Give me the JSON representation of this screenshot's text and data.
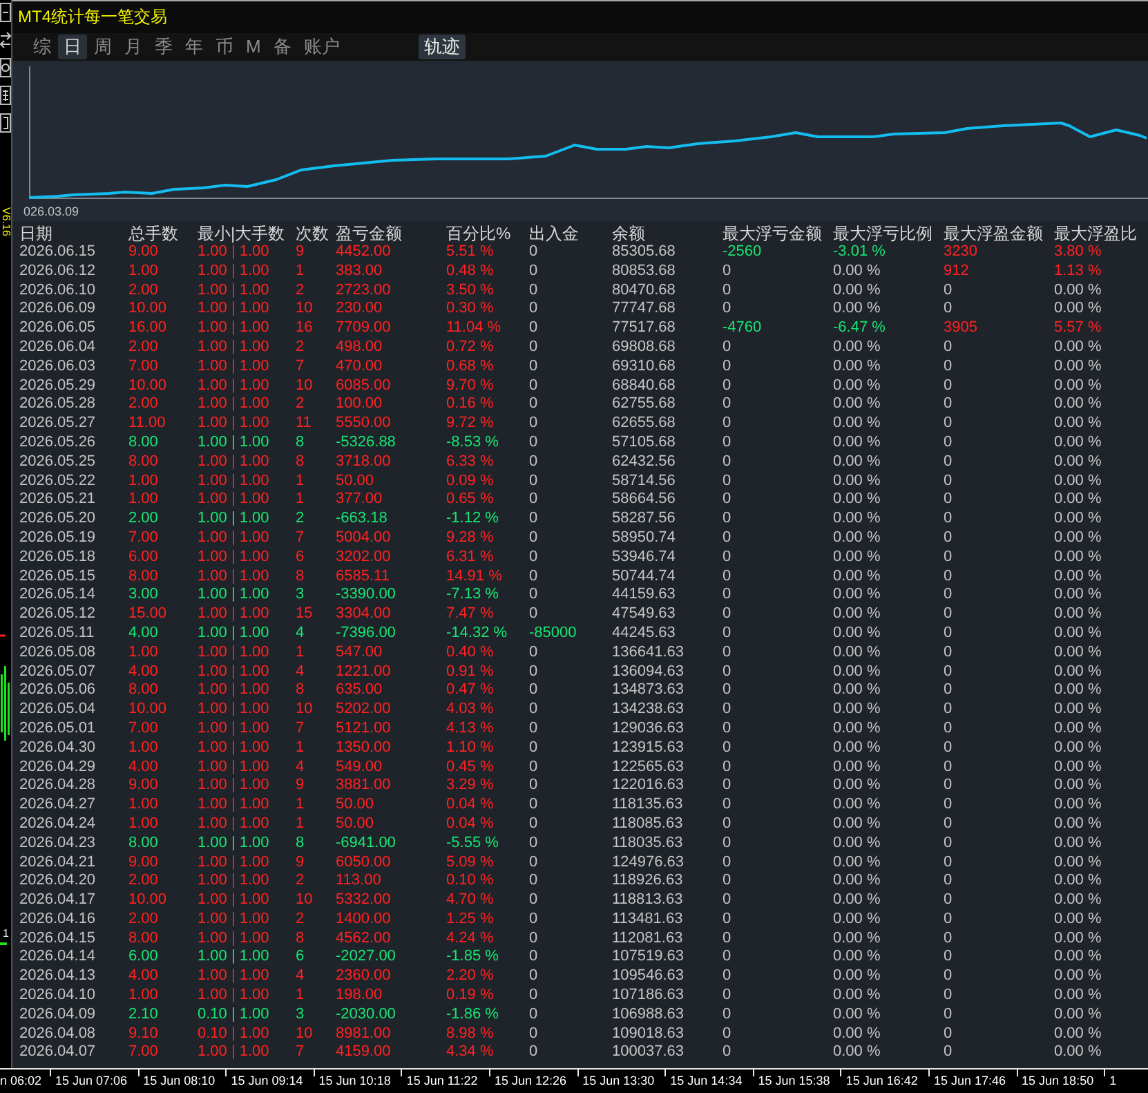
{
  "window": {
    "title": "MT4统计每一笔交易"
  },
  "side_label": "V6.16",
  "price_label": "1",
  "tabs": [
    {
      "label": "综",
      "selected": false
    },
    {
      "label": "日",
      "selected": true
    },
    {
      "label": "周",
      "selected": false
    },
    {
      "label": "月",
      "selected": false
    },
    {
      "label": "季",
      "selected": false
    },
    {
      "label": "年",
      "selected": false
    },
    {
      "label": "币",
      "selected": false
    },
    {
      "label": "M",
      "selected": false
    },
    {
      "label": "备",
      "selected": false
    },
    {
      "label": "账户",
      "selected": false
    }
  ],
  "trajectory_button": {
    "label": "轨迹",
    "on": true
  },
  "chart": {
    "start_label": "026.03.09"
  },
  "table": {
    "columns": [
      {
        "label": "日期",
        "kind": "plain"
      },
      {
        "label": "总手数",
        "kind": "result"
      },
      {
        "label": "最小|大手数",
        "kind": "result"
      },
      {
        "label": "次数",
        "kind": "result"
      },
      {
        "label": "盈亏金额",
        "kind": "result"
      },
      {
        "label": "百分比%",
        "kind": "result"
      },
      {
        "label": "出入金",
        "kind": "withdrawal"
      },
      {
        "label": "余额",
        "kind": "plain"
      },
      {
        "label": "最大浮亏金额",
        "kind": "floating_loss"
      },
      {
        "label": "最大浮亏比例",
        "kind": "floating_loss"
      },
      {
        "label": "最大浮盈金额",
        "kind": "floating_gain"
      },
      {
        "label": "最大浮盈比",
        "kind": "floating_gain"
      }
    ],
    "rows": [
      {
        "kind": "gain",
        "withdrawal": false,
        "floating_loss": true,
        "floating_gain": true,
        "cells": [
          "2026.06.15",
          "9.00",
          "1.00 | 1.00",
          "9",
          "4452.00",
          "5.51 %",
          "0",
          "85305.68",
          "-2560",
          "-3.01 %",
          "3230",
          "3.80 %"
        ]
      },
      {
        "kind": "gain",
        "withdrawal": false,
        "floating_loss": false,
        "floating_gain": true,
        "cells": [
          "2026.06.12",
          "1.00",
          "1.00 | 1.00",
          "1",
          "383.00",
          "0.48 %",
          "0",
          "80853.68",
          "0",
          "0.00 %",
          "912",
          "1.13 %"
        ]
      },
      {
        "kind": "gain",
        "withdrawal": false,
        "floating_loss": false,
        "floating_gain": false,
        "cells": [
          "2026.06.10",
          "2.00",
          "1.00 | 1.00",
          "2",
          "2723.00",
          "3.50 %",
          "0",
          "80470.68",
          "0",
          "0.00 %",
          "0",
          "0.00 %"
        ]
      },
      {
        "kind": "gain",
        "withdrawal": false,
        "floating_loss": false,
        "floating_gain": false,
        "cells": [
          "2026.06.09",
          "10.00",
          "1.00 | 1.00",
          "10",
          "230.00",
          "0.30 %",
          "0",
          "77747.68",
          "0",
          "0.00 %",
          "0",
          "0.00 %"
        ]
      },
      {
        "kind": "gain",
        "withdrawal": false,
        "floating_loss": true,
        "floating_gain": true,
        "cells": [
          "2026.06.05",
          "16.00",
          "1.00 | 1.00",
          "16",
          "7709.00",
          "11.04 %",
          "0",
          "77517.68",
          "-4760",
          "-6.47 %",
          "3905",
          "5.57 %"
        ]
      },
      {
        "kind": "gain",
        "withdrawal": false,
        "floating_loss": false,
        "floating_gain": false,
        "cells": [
          "2026.06.04",
          "2.00",
          "1.00 | 1.00",
          "2",
          "498.00",
          "0.72 %",
          "0",
          "69808.68",
          "0",
          "0.00 %",
          "0",
          "0.00 %"
        ]
      },
      {
        "kind": "gain",
        "withdrawal": false,
        "floating_loss": false,
        "floating_gain": false,
        "cells": [
          "2026.06.03",
          "7.00",
          "1.00 | 1.00",
          "7",
          "470.00",
          "0.68 %",
          "0",
          "69310.68",
          "0",
          "0.00 %",
          "0",
          "0.00 %"
        ]
      },
      {
        "kind": "gain",
        "withdrawal": false,
        "floating_loss": false,
        "floating_gain": false,
        "cells": [
          "2026.05.29",
          "10.00",
          "1.00 | 1.00",
          "10",
          "6085.00",
          "9.70 %",
          "0",
          "68840.68",
          "0",
          "0.00 %",
          "0",
          "0.00 %"
        ]
      },
      {
        "kind": "gain",
        "withdrawal": false,
        "floating_loss": false,
        "floating_gain": false,
        "cells": [
          "2026.05.28",
          "2.00",
          "1.00 | 1.00",
          "2",
          "100.00",
          "0.16 %",
          "0",
          "62755.68",
          "0",
          "0.00 %",
          "0",
          "0.00 %"
        ]
      },
      {
        "kind": "gain",
        "withdrawal": false,
        "floating_loss": false,
        "floating_gain": false,
        "cells": [
          "2026.05.27",
          "11.00",
          "1.00 | 1.00",
          "11",
          "5550.00",
          "9.72 %",
          "0",
          "62655.68",
          "0",
          "0.00 %",
          "0",
          "0.00 %"
        ]
      },
      {
        "kind": "loss",
        "withdrawal": false,
        "floating_loss": false,
        "floating_gain": false,
        "cells": [
          "2026.05.26",
          "8.00",
          "1.00 | 1.00",
          "8",
          "-5326.88",
          "-8.53 %",
          "0",
          "57105.68",
          "0",
          "0.00 %",
          "0",
          "0.00 %"
        ]
      },
      {
        "kind": "gain",
        "withdrawal": false,
        "floating_loss": false,
        "floating_gain": false,
        "cells": [
          "2026.05.25",
          "8.00",
          "1.00 | 1.00",
          "8",
          "3718.00",
          "6.33 %",
          "0",
          "62432.56",
          "0",
          "0.00 %",
          "0",
          "0.00 %"
        ]
      },
      {
        "kind": "gain",
        "withdrawal": false,
        "floating_loss": false,
        "floating_gain": false,
        "cells": [
          "2026.05.22",
          "1.00",
          "1.00 | 1.00",
          "1",
          "50.00",
          "0.09 %",
          "0",
          "58714.56",
          "0",
          "0.00 %",
          "0",
          "0.00 %"
        ]
      },
      {
        "kind": "gain",
        "withdrawal": false,
        "floating_loss": false,
        "floating_gain": false,
        "cells": [
          "2026.05.21",
          "1.00",
          "1.00 | 1.00",
          "1",
          "377.00",
          "0.65 %",
          "0",
          "58664.56",
          "0",
          "0.00 %",
          "0",
          "0.00 %"
        ]
      },
      {
        "kind": "loss",
        "withdrawal": false,
        "floating_loss": false,
        "floating_gain": false,
        "cells": [
          "2026.05.20",
          "2.00",
          "1.00 | 1.00",
          "2",
          "-663.18",
          "-1.12 %",
          "0",
          "58287.56",
          "0",
          "0.00 %",
          "0",
          "0.00 %"
        ]
      },
      {
        "kind": "gain",
        "withdrawal": false,
        "floating_loss": false,
        "floating_gain": false,
        "cells": [
          "2026.05.19",
          "7.00",
          "1.00 | 1.00",
          "7",
          "5004.00",
          "9.28 %",
          "0",
          "58950.74",
          "0",
          "0.00 %",
          "0",
          "0.00 %"
        ]
      },
      {
        "kind": "gain",
        "withdrawal": false,
        "floating_loss": false,
        "floating_gain": false,
        "cells": [
          "2026.05.18",
          "6.00",
          "1.00 | 1.00",
          "6",
          "3202.00",
          "6.31 %",
          "0",
          "53946.74",
          "0",
          "0.00 %",
          "0",
          "0.00 %"
        ]
      },
      {
        "kind": "gain",
        "withdrawal": false,
        "floating_loss": false,
        "floating_gain": false,
        "cells": [
          "2026.05.15",
          "8.00",
          "1.00 | 1.00",
          "8",
          "6585.11",
          "14.91 %",
          "0",
          "50744.74",
          "0",
          "0.00 %",
          "0",
          "0.00 %"
        ]
      },
      {
        "kind": "loss",
        "withdrawal": false,
        "floating_loss": false,
        "floating_gain": false,
        "cells": [
          "2026.05.14",
          "3.00",
          "1.00 | 1.00",
          "3",
          "-3390.00",
          "-7.13 %",
          "0",
          "44159.63",
          "0",
          "0.00 %",
          "0",
          "0.00 %"
        ]
      },
      {
        "kind": "gain",
        "withdrawal": false,
        "floating_loss": false,
        "floating_gain": false,
        "cells": [
          "2026.05.12",
          "15.00",
          "1.00 | 1.00",
          "15",
          "3304.00",
          "7.47 %",
          "0",
          "47549.63",
          "0",
          "0.00 %",
          "0",
          "0.00 %"
        ]
      },
      {
        "kind": "loss",
        "withdrawal": true,
        "floating_loss": false,
        "floating_gain": false,
        "cells": [
          "2026.05.11",
          "4.00",
          "1.00 | 1.00",
          "4",
          "-7396.00",
          "-14.32 %",
          "-85000",
          "44245.63",
          "0",
          "0.00 %",
          "0",
          "0.00 %"
        ]
      },
      {
        "kind": "gain",
        "withdrawal": false,
        "floating_loss": false,
        "floating_gain": false,
        "cells": [
          "2026.05.08",
          "1.00",
          "1.00 | 1.00",
          "1",
          "547.00",
          "0.40 %",
          "0",
          "136641.63",
          "0",
          "0.00 %",
          "0",
          "0.00 %"
        ]
      },
      {
        "kind": "gain",
        "withdrawal": false,
        "floating_loss": false,
        "floating_gain": false,
        "cells": [
          "2026.05.07",
          "4.00",
          "1.00 | 1.00",
          "4",
          "1221.00",
          "0.91 %",
          "0",
          "136094.63",
          "0",
          "0.00 %",
          "0",
          "0.00 %"
        ]
      },
      {
        "kind": "gain",
        "withdrawal": false,
        "floating_loss": false,
        "floating_gain": false,
        "cells": [
          "2026.05.06",
          "8.00",
          "1.00 | 1.00",
          "8",
          "635.00",
          "0.47 %",
          "0",
          "134873.63",
          "0",
          "0.00 %",
          "0",
          "0.00 %"
        ]
      },
      {
        "kind": "gain",
        "withdrawal": false,
        "floating_loss": false,
        "floating_gain": false,
        "cells": [
          "2026.05.04",
          "10.00",
          "1.00 | 1.00",
          "10",
          "5202.00",
          "4.03 %",
          "0",
          "134238.63",
          "0",
          "0.00 %",
          "0",
          "0.00 %"
        ]
      },
      {
        "kind": "gain",
        "withdrawal": false,
        "floating_loss": false,
        "floating_gain": false,
        "cells": [
          "2026.05.01",
          "7.00",
          "1.00 | 1.00",
          "7",
          "5121.00",
          "4.13 %",
          "0",
          "129036.63",
          "0",
          "0.00 %",
          "0",
          "0.00 %"
        ]
      },
      {
        "kind": "gain",
        "withdrawal": false,
        "floating_loss": false,
        "floating_gain": false,
        "cells": [
          "2026.04.30",
          "1.00",
          "1.00 | 1.00",
          "1",
          "1350.00",
          "1.10 %",
          "0",
          "123915.63",
          "0",
          "0.00 %",
          "0",
          "0.00 %"
        ]
      },
      {
        "kind": "gain",
        "withdrawal": false,
        "floating_loss": false,
        "floating_gain": false,
        "cells": [
          "2026.04.29",
          "4.00",
          "1.00 | 1.00",
          "4",
          "549.00",
          "0.45 %",
          "0",
          "122565.63",
          "0",
          "0.00 %",
          "0",
          "0.00 %"
        ]
      },
      {
        "kind": "gain",
        "withdrawal": false,
        "floating_loss": false,
        "floating_gain": false,
        "cells": [
          "2026.04.28",
          "9.00",
          "1.00 | 1.00",
          "9",
          "3881.00",
          "3.29 %",
          "0",
          "122016.63",
          "0",
          "0.00 %",
          "0",
          "0.00 %"
        ]
      },
      {
        "kind": "gain",
        "withdrawal": false,
        "floating_loss": false,
        "floating_gain": false,
        "cells": [
          "2026.04.27",
          "1.00",
          "1.00 | 1.00",
          "1",
          "50.00",
          "0.04 %",
          "0",
          "118135.63",
          "0",
          "0.00 %",
          "0",
          "0.00 %"
        ]
      },
      {
        "kind": "gain",
        "withdrawal": false,
        "floating_loss": false,
        "floating_gain": false,
        "cells": [
          "2026.04.24",
          "1.00",
          "1.00 | 1.00",
          "1",
          "50.00",
          "0.04 %",
          "0",
          "118085.63",
          "0",
          "0.00 %",
          "0",
          "0.00 %"
        ]
      },
      {
        "kind": "loss",
        "withdrawal": false,
        "floating_loss": false,
        "floating_gain": false,
        "cells": [
          "2026.04.23",
          "8.00",
          "1.00 | 1.00",
          "8",
          "-6941.00",
          "-5.55 %",
          "0",
          "118035.63",
          "0",
          "0.00 %",
          "0",
          "0.00 %"
        ]
      },
      {
        "kind": "gain",
        "withdrawal": false,
        "floating_loss": false,
        "floating_gain": false,
        "cells": [
          "2026.04.21",
          "9.00",
          "1.00 | 1.00",
          "9",
          "6050.00",
          "5.09 %",
          "0",
          "124976.63",
          "0",
          "0.00 %",
          "0",
          "0.00 %"
        ]
      },
      {
        "kind": "gain",
        "withdrawal": false,
        "floating_loss": false,
        "floating_gain": false,
        "cells": [
          "2026.04.20",
          "2.00",
          "1.00 | 1.00",
          "2",
          "113.00",
          "0.10 %",
          "0",
          "118926.63",
          "0",
          "0.00 %",
          "0",
          "0.00 %"
        ]
      },
      {
        "kind": "gain",
        "withdrawal": false,
        "floating_loss": false,
        "floating_gain": false,
        "cells": [
          "2026.04.17",
          "10.00",
          "1.00 | 1.00",
          "10",
          "5332.00",
          "4.70 %",
          "0",
          "118813.63",
          "0",
          "0.00 %",
          "0",
          "0.00 %"
        ]
      },
      {
        "kind": "gain",
        "withdrawal": false,
        "floating_loss": false,
        "floating_gain": false,
        "cells": [
          "2026.04.16",
          "2.00",
          "1.00 | 1.00",
          "2",
          "1400.00",
          "1.25 %",
          "0",
          "113481.63",
          "0",
          "0.00 %",
          "0",
          "0.00 %"
        ]
      },
      {
        "kind": "gain",
        "withdrawal": false,
        "floating_loss": false,
        "floating_gain": false,
        "cells": [
          "2026.04.15",
          "8.00",
          "1.00 | 1.00",
          "8",
          "4562.00",
          "4.24 %",
          "0",
          "112081.63",
          "0",
          "0.00 %",
          "0",
          "0.00 %"
        ]
      },
      {
        "kind": "loss",
        "withdrawal": false,
        "floating_loss": false,
        "floating_gain": false,
        "cells": [
          "2026.04.14",
          "6.00",
          "1.00 | 1.00",
          "6",
          "-2027.00",
          "-1.85 %",
          "0",
          "107519.63",
          "0",
          "0.00 %",
          "0",
          "0.00 %"
        ]
      },
      {
        "kind": "gain",
        "withdrawal": false,
        "floating_loss": false,
        "floating_gain": false,
        "cells": [
          "2026.04.13",
          "4.00",
          "1.00 | 1.00",
          "4",
          "2360.00",
          "2.20 %",
          "0",
          "109546.63",
          "0",
          "0.00 %",
          "0",
          "0.00 %"
        ]
      },
      {
        "kind": "gain",
        "withdrawal": false,
        "floating_loss": false,
        "floating_gain": false,
        "cells": [
          "2026.04.10",
          "1.00",
          "1.00 | 1.00",
          "1",
          "198.00",
          "0.19 %",
          "0",
          "107186.63",
          "0",
          "0.00 %",
          "0",
          "0.00 %"
        ]
      },
      {
        "kind": "loss",
        "withdrawal": false,
        "floating_loss": false,
        "floating_gain": false,
        "cells": [
          "2026.04.09",
          "2.10",
          "0.10 | 1.00",
          "3",
          "-2030.00",
          "-1.86 %",
          "0",
          "106988.63",
          "0",
          "0.00 %",
          "0",
          "0.00 %"
        ]
      },
      {
        "kind": "gain",
        "withdrawal": false,
        "floating_loss": false,
        "floating_gain": false,
        "cells": [
          "2026.04.08",
          "9.10",
          "0.10 | 1.00",
          "10",
          "8981.00",
          "8.98 %",
          "0",
          "109018.63",
          "0",
          "0.00 %",
          "0",
          "0.00 %"
        ]
      },
      {
        "kind": "gain",
        "withdrawal": false,
        "floating_loss": false,
        "floating_gain": false,
        "cells": [
          "2026.04.07",
          "7.00",
          "1.00 | 1.00",
          "7",
          "4159.00",
          "4.34 %",
          "0",
          "100037.63",
          "0",
          "0.00 %",
          "0",
          "0.00 %"
        ]
      }
    ]
  },
  "time_axis": {
    "labels": [
      "n 06:02",
      "15 Jun 07:06",
      "15 Jun 08:10",
      "15 Jun 09:14",
      "15 Jun 10:18",
      "15 Jun 11:22",
      "15 Jun 12:26",
      "15 Jun 13:30",
      "15 Jun 14:34",
      "15 Jun 15:38",
      "15 Jun 16:42",
      "15 Jun 17:46",
      "15 Jun 18:50",
      "1"
    ]
  }
}
